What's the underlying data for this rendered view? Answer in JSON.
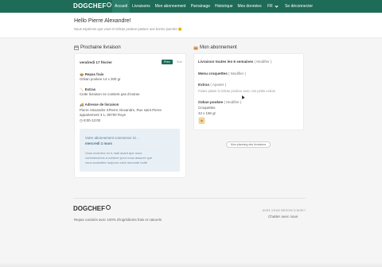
{
  "nav": {
    "logo": "DOGCHEF",
    "items": [
      "Accueil",
      "Livraisons",
      "Mon abonnement",
      "Parrainage",
      "Historique",
      "Mes données"
    ],
    "active_index": 0,
    "lang": "FR",
    "logout": "Se déconnecter",
    "brand_color": "#1e6b57"
  },
  "hero": {
    "greeting": "Hello Pierre Alexandre!",
    "subtitle": "Nous espérons que vous et Ozkan pookee passez une bonne journée 😊"
  },
  "delivery": {
    "section_title": "Prochaine livraison",
    "date": "vendredi 17 février",
    "toggle_on": "Prev",
    "toggle_off": "Suiv",
    "meals_label": "Repas frais",
    "meals_value": "Ozkan pookee 14 x 300 gr",
    "extras_label": "Extras",
    "extras_value": "Cette livraison ne contient pas d'extras",
    "address_label": "Adresse de livraison",
    "address_line1": "Pierre Alexandre XPierre Alexandre, Rue saint Pierre",
    "address_line2": "appartement 3 1, 80700 Roye",
    "time": "8:00-13:00",
    "info_title": "Votre abonnement commence ici ...",
    "info_date": "mercredi 1 mars",
    "info_text_1": "Vous recevrez un e-mail avant que nous",
    "info_text_2": "commencions à cuisiner pour nous assurer que",
    "info_text_3": "vous souhaitez toujours votre seconde boite"
  },
  "subscription": {
    "section_title": "Mon abonnement",
    "frequency": "Livraison toutes les 6 semaines",
    "modify": "( Modifier )",
    "menu_label": "Menu croquettes",
    "extras_label": "Extras",
    "add": "( Ajouter )",
    "extras_hint": "Faites plaisir à Ozkan pookee avec nos petits extras",
    "dog_name": "Ozkan pookee",
    "product_type": "Croquettes",
    "product_qty": "42 x 156 gr",
    "planning_button": "Mon planning des livraisons"
  },
  "footer": {
    "logo": "DOGCHEF",
    "tagline": "Repas cuisinés avec 100% d'ingrédients frais et naturels",
    "help_question": "AVEZ-VOUS BESOIN D'AIDE?",
    "help_link": "Chatter avec nous"
  }
}
